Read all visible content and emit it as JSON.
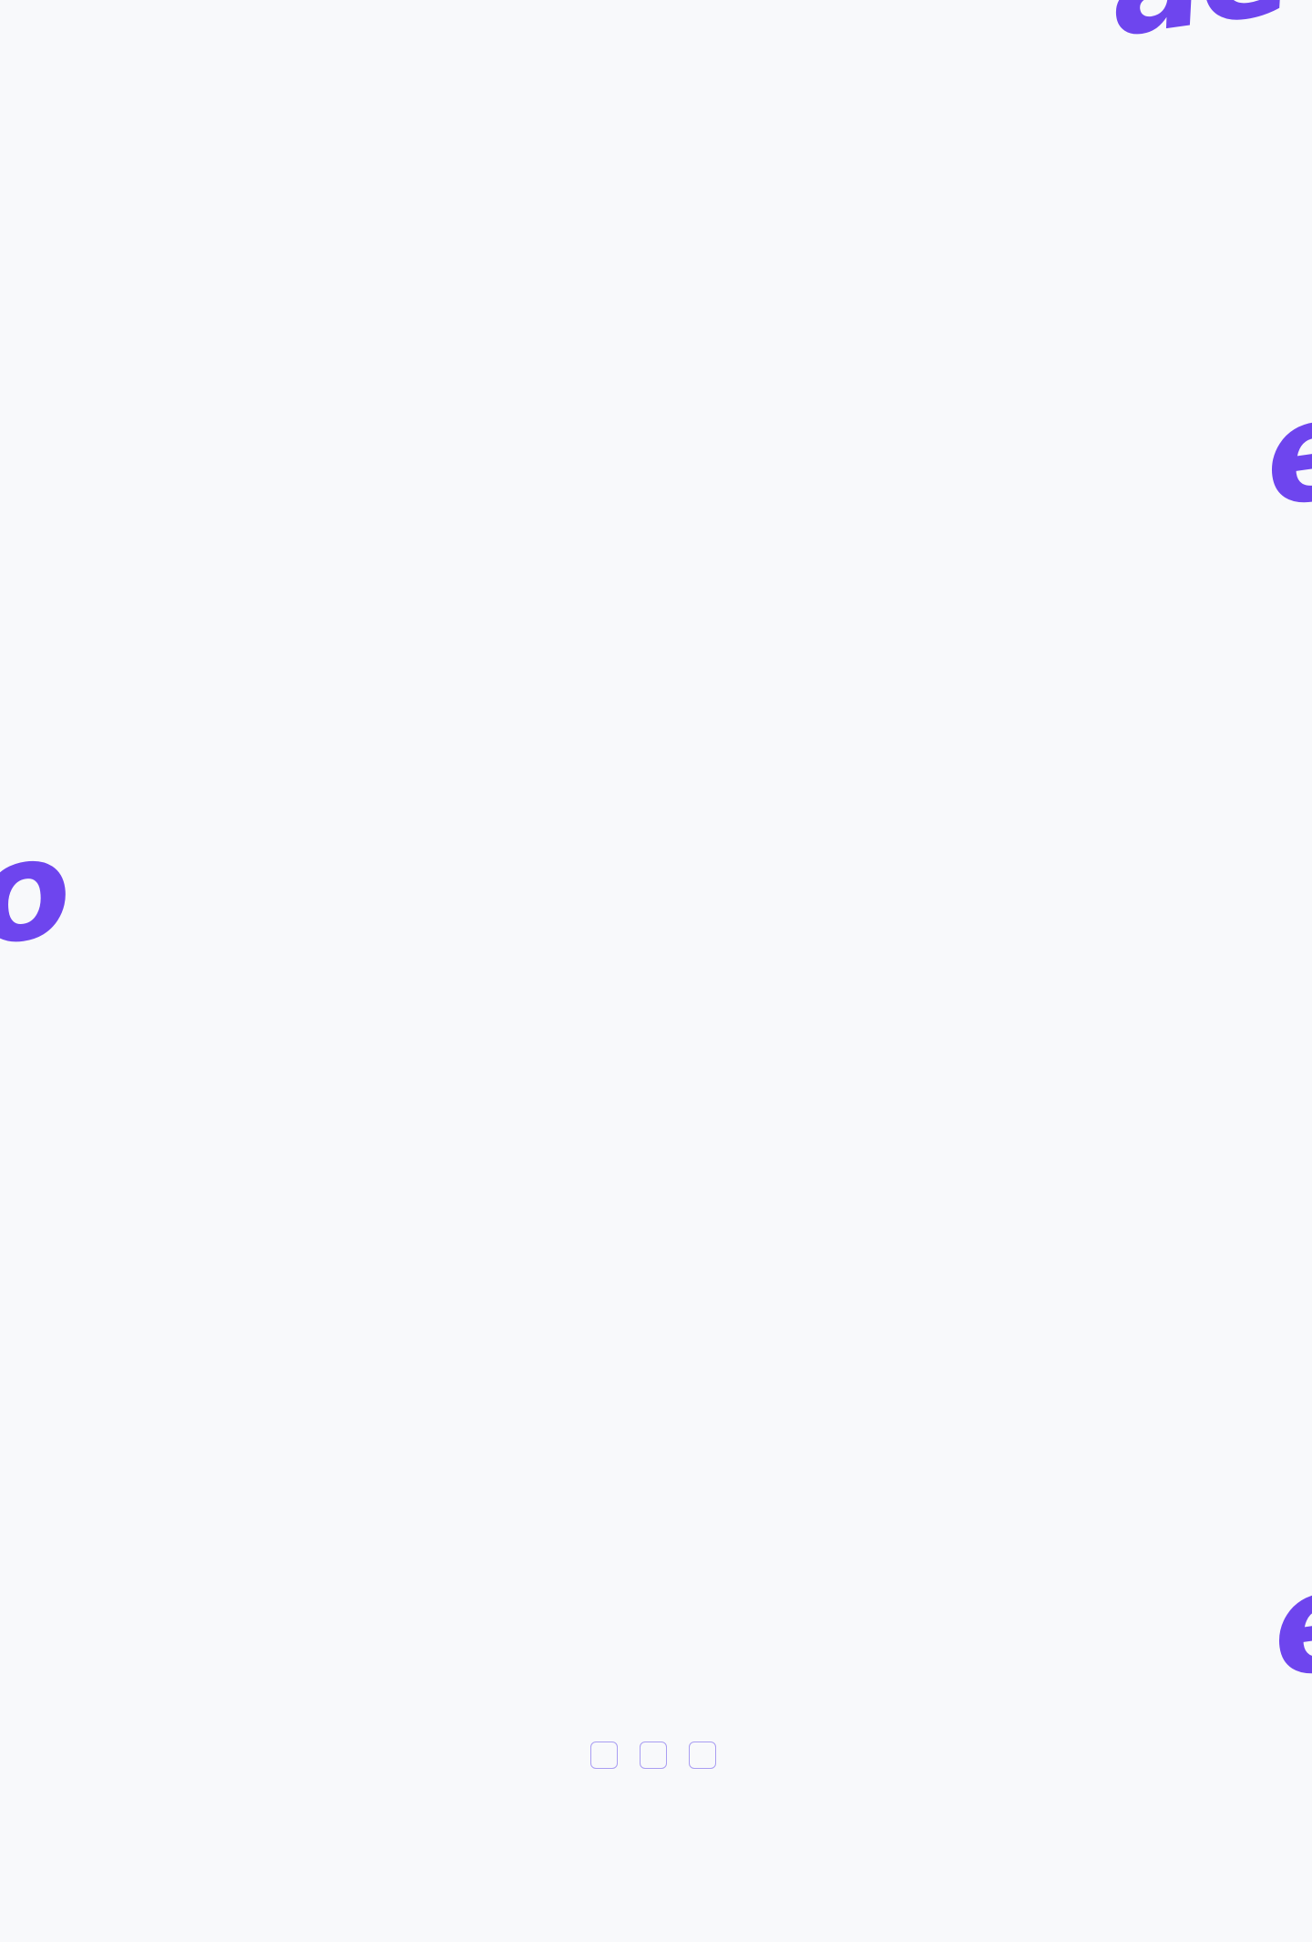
{
  "decorations": {
    "top_right": "ae",
    "upper_right": "e",
    "left_middle": "o",
    "lower_right": "e"
  },
  "pagination": {
    "slide_count": 3,
    "active_index": null
  },
  "colors": {
    "background": "#f8f9fb",
    "accent": "#6e45ee",
    "dot_border": "#a99df2"
  }
}
